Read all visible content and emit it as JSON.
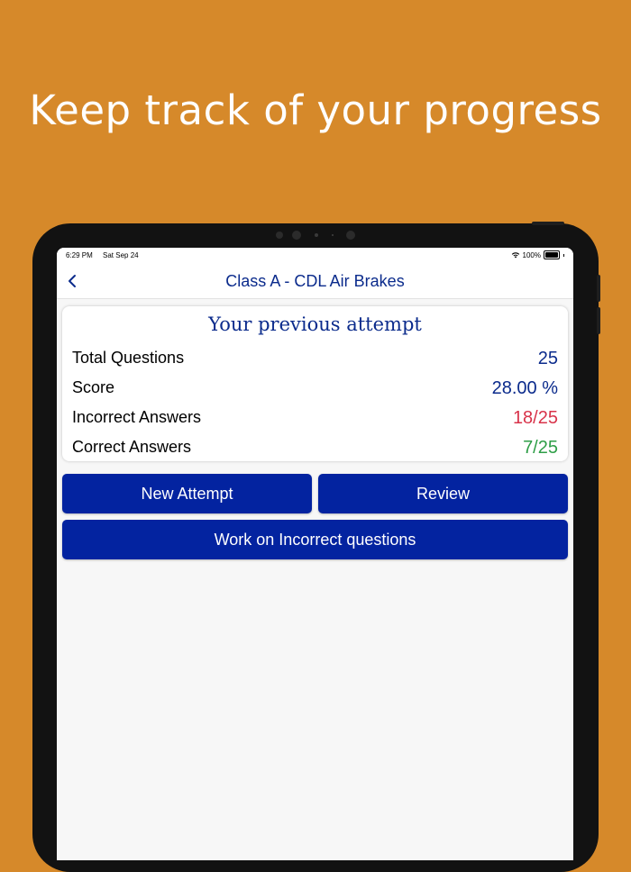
{
  "headline": "Keep track of your progress",
  "status_bar": {
    "time": "6:29 PM",
    "date": "Sat Sep 24",
    "battery": "100%"
  },
  "nav": {
    "title": "Class A - CDL Air Brakes",
    "back_icon": "chevron-left-icon"
  },
  "summary": {
    "title": "Your previous attempt",
    "rows": [
      {
        "label": "Total Questions",
        "value": "25",
        "color": "#0B2B8C"
      },
      {
        "label": "Score",
        "value": "28.00 %",
        "color": "#0B2B8C"
      },
      {
        "label": "Incorrect Answers",
        "value": "18/25",
        "color": "#D8334A"
      },
      {
        "label": "Correct Answers",
        "value": "7/25",
        "color": "#2E9E47"
      }
    ]
  },
  "actions": {
    "new_attempt": "New Attempt",
    "review": "Review",
    "work_incorrect": "Work on Incorrect questions"
  },
  "colors": {
    "background": "#D6892A",
    "accent": "#0323A0",
    "title_blue": "#0B2B8C"
  }
}
